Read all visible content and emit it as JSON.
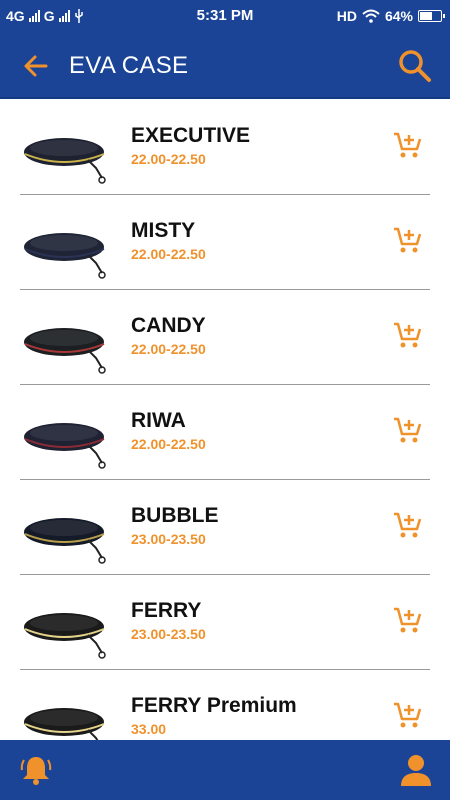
{
  "status_bar": {
    "network_1": "4G",
    "network_2": "G",
    "time": "5:31 PM",
    "hd": "HD",
    "battery": "64%",
    "battery_level": 0.64
  },
  "header": {
    "title": "EVA CASE",
    "back_icon": "arrow-left-icon",
    "search_icon": "search-icon"
  },
  "colors": {
    "primary": "#1b4496",
    "accent": "#f0922c",
    "divider": "#9a9a9a"
  },
  "products": [
    {
      "name": "EXECUTIVE",
      "price": "22.00-22.50",
      "stripe": "#c9b24a",
      "body": "#1e2130"
    },
    {
      "name": "MISTY",
      "price": "22.00-22.50",
      "stripe": "#2a3355",
      "body": "#1f2436"
    },
    {
      "name": "CANDY",
      "price": "22.00-22.50",
      "stripe": "#a83838",
      "body": "#1c1f22"
    },
    {
      "name": "RIWA",
      "price": "22.00-22.50",
      "stripe": "#8a2b36",
      "body": "#1e2233"
    },
    {
      "name": "BUBBLE",
      "price": "23.00-23.50",
      "stripe": "#b8a04a",
      "body": "#151a28"
    },
    {
      "name": "FERRY",
      "price": "23.00-23.50",
      "stripe": "#e5d48a",
      "body": "#1a1a1a"
    },
    {
      "name": "FERRY Premium",
      "price": "33.00",
      "stripe": "#e5d48a",
      "body": "#1a1a1a"
    }
  ],
  "bottom_bar": {
    "bell_icon": "bell-icon",
    "user_icon": "user-icon"
  }
}
